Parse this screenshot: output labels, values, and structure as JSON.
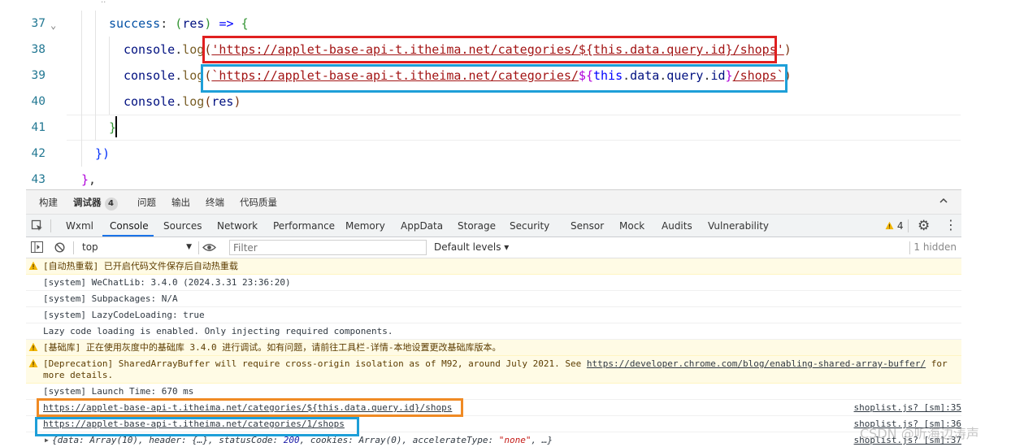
{
  "editor": {
    "lines": [
      {
        "num": "37",
        "indent": 134,
        "tokens": [
          [
            "success",
            "k-prop"
          ],
          [
            ": ",
            "k-punc"
          ],
          [
            "(",
            "k-br2"
          ],
          [
            "res",
            "k-id"
          ],
          [
            ")",
            "k-br2"
          ],
          [
            " => ",
            "k-kw"
          ],
          [
            "{",
            "k-br2"
          ]
        ]
      },
      {
        "num": "38",
        "indent": 152,
        "tokens": [
          [
            "console",
            "k-id"
          ],
          [
            ".",
            "k-punc"
          ],
          [
            "log",
            "k-fn"
          ],
          [
            "(",
            "k-br3"
          ],
          [
            "'https://applet-base-api-t.itheima.net/categories/${this.data.query.id}/shops'",
            "k-str"
          ],
          [
            ")",
            "k-br3"
          ]
        ]
      },
      {
        "num": "39",
        "indent": 152,
        "tokens": [
          [
            "console",
            "k-id"
          ],
          [
            ".",
            "k-punc"
          ],
          [
            "log",
            "k-fn"
          ],
          [
            "(",
            "k-br3"
          ],
          [
            "`https://applet-base-api-t.itheima.net/categories/",
            "k-str"
          ],
          [
            "${",
            "k-pur"
          ],
          [
            "this",
            "k-kw"
          ],
          [
            ".",
            "k-punc"
          ],
          [
            "data",
            "k-id"
          ],
          [
            ".",
            "k-punc"
          ],
          [
            "query",
            "k-id"
          ],
          [
            ".",
            "k-punc"
          ],
          [
            "id",
            "k-id"
          ],
          [
            "}",
            "k-pur"
          ],
          [
            "/shops`",
            "k-str"
          ],
          [
            ")",
            "k-br3"
          ]
        ]
      },
      {
        "num": "40",
        "indent": 152,
        "tokens": [
          [
            "console",
            "k-id"
          ],
          [
            ".",
            "k-punc"
          ],
          [
            "log",
            "k-fn"
          ],
          [
            "(",
            "k-br3"
          ],
          [
            "res",
            "k-id"
          ],
          [
            ")",
            "k-br3"
          ]
        ]
      },
      {
        "num": "41",
        "indent": 134,
        "tokens": [
          [
            "}",
            "k-br2"
          ]
        ]
      },
      {
        "num": "42",
        "indent": 117,
        "tokens": [
          [
            "}",
            "k-br1"
          ],
          [
            ")",
            "k-br1"
          ]
        ]
      },
      {
        "num": "43",
        "indent": 100,
        "tokens": [
          [
            "}",
            "k-pur"
          ],
          [
            ",",
            "k-punc"
          ]
        ]
      }
    ]
  },
  "panel_tabs": [
    {
      "label": "构建",
      "active": false
    },
    {
      "label": "调试器",
      "active": true,
      "badge": "4"
    },
    {
      "label": "问题",
      "active": false
    },
    {
      "label": "输出",
      "active": false
    },
    {
      "label": "终端",
      "active": false
    },
    {
      "label": "代码质量",
      "active": false
    }
  ],
  "devtools_tabs": [
    "Wxml",
    "Console",
    "Sources",
    "Network",
    "Performance",
    "Memory",
    "AppData",
    "Storage",
    "Security",
    "Sensor",
    "Mock",
    "Audits",
    "Vulnerability"
  ],
  "active_devtools_tab": "Console",
  "warning_count": "4",
  "filter": {
    "context": "top",
    "placeholder": "Filter",
    "levels": "Default levels ▾",
    "hidden": "1 hidden"
  },
  "logs": [
    {
      "type": "warn",
      "text": "[自动热重载] 已开启代码文件保存后自动热重载"
    },
    {
      "type": "log",
      "text": "[system] WeChatLib: 3.4.0 (2024.3.31 23:36:20)"
    },
    {
      "type": "log",
      "text": "[system] Subpackages: N/A"
    },
    {
      "type": "log",
      "text": "[system] LazyCodeLoading: true"
    },
    {
      "type": "log",
      "text": "Lazy code loading is enabled. Only injecting required components."
    },
    {
      "type": "warn",
      "text": "[基础库] 正在使用灰度中的基础库 3.4.0 进行调试。如有问题，请前往工具栏-详情-本地设置更改基础库版本。"
    },
    {
      "type": "warn",
      "text": "[Deprecation] SharedArrayBuffer will require cross-origin isolation as of M92, around July 2021. See ",
      "link": "https://developer.chrome.com/blog/enabling-shared-array-buffer/",
      "tail": " for",
      "line2": "more details."
    },
    {
      "type": "log",
      "text": "[system] Launch Time: 670 ms"
    },
    {
      "type": "url",
      "text": "https://applet-base-api-t.itheima.net/categories/${this.data.query.id}/shops",
      "source": "shoplist.js? [sm]:35"
    },
    {
      "type": "url",
      "text": "https://applet-base-api-t.itheima.net/categories/1/shops",
      "source": "shoplist.js? [sm]:36"
    },
    {
      "type": "obj",
      "source": "shoplist.js? [sm]:37"
    }
  ],
  "object_preview": {
    "open": "{data: Array(10), header: {…}, statusCode: ",
    "status": "200",
    "mid": ", cookies: Array(0), accelerateType: ",
    "accel": "\"none\"",
    "close": ", …}"
  },
  "watermark": "CSDN @听海边涛声",
  "colors": {
    "red_box": "#e02020",
    "blue_box": "#1e9fd8",
    "orange_box": "#f08a24",
    "active_tab_underline": "#1a73e8",
    "warning_bg": "#fffbe5"
  }
}
